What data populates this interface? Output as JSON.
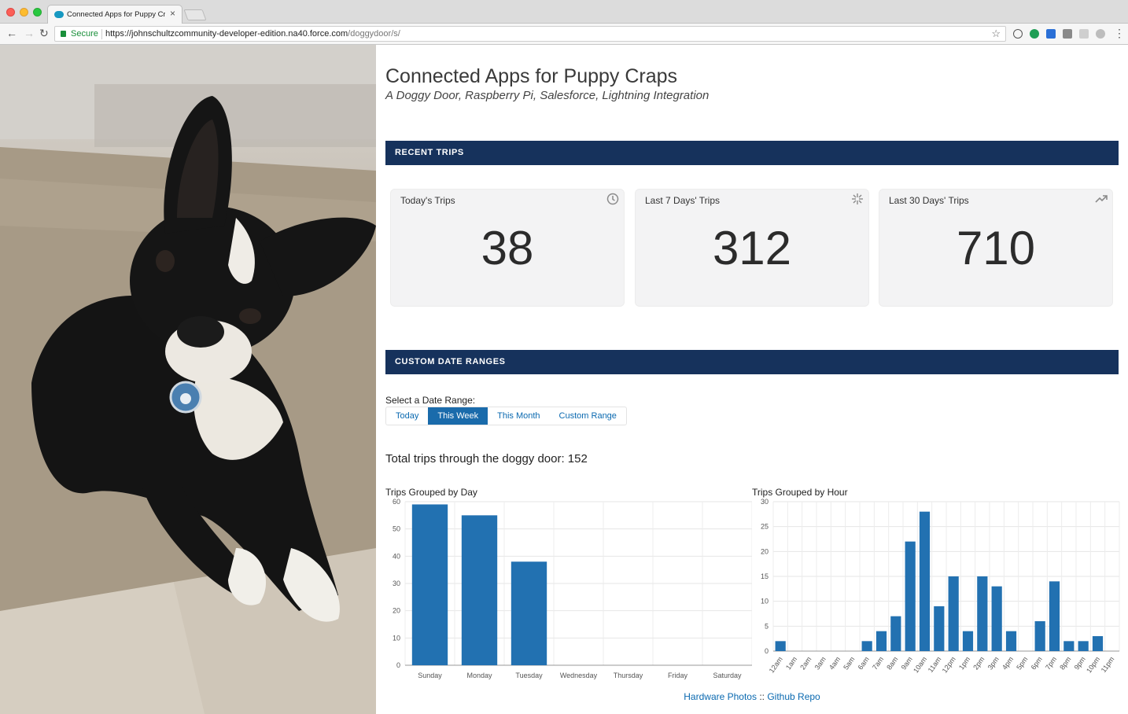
{
  "browser": {
    "tab_title": "Connected Apps for Puppy Cr",
    "tab_close": "×",
    "secure_label": "Secure",
    "url_host": "https://johnschultzcommunity-developer-edition.na40.force.com",
    "url_path": "/doggydoor/s/",
    "back_icon": "arrow-left-icon",
    "forward_icon": "arrow-right-icon",
    "reload_icon": "reload-icon"
  },
  "page": {
    "title": "Connected Apps for Puppy Craps",
    "subtitle": "A Doggy Door, Raspberry Pi, Salesforce, Lightning Integration"
  },
  "recent_trips": {
    "heading": "RECENT TRIPS",
    "cards": [
      {
        "label": "Today's Trips",
        "value": "38",
        "icon": "clock-icon"
      },
      {
        "label": "Last 7 Days' Trips",
        "value": "312",
        "icon": "sparkle-icon"
      },
      {
        "label": "Last 30 Days' Trips",
        "value": "710",
        "icon": "trend-up-icon"
      }
    ]
  },
  "custom_ranges": {
    "heading": "CUSTOM DATE RANGES",
    "select_label": "Select a Date Range:",
    "buttons": [
      "Today",
      "This Week",
      "This Month",
      "Custom Range"
    ],
    "selected": "This Week",
    "total_text": "Total trips through the doggy door: 152"
  },
  "footer": {
    "link1": "Hardware Photos",
    "separator": "::",
    "link2": "Github Repo"
  },
  "colors": {
    "section_bar": "#16325c",
    "bar": "#2271b1",
    "link": "#0a69b0"
  },
  "chart_data": [
    {
      "type": "bar",
      "title": "Trips Grouped by Day",
      "categories": [
        "Sunday",
        "Monday",
        "Tuesday",
        "Wednesday",
        "Thursday",
        "Friday",
        "Saturday"
      ],
      "values": [
        59,
        55,
        38,
        0,
        0,
        0,
        0
      ],
      "ylim": [
        0,
        60
      ],
      "yticks": [
        0,
        10,
        20,
        30,
        40,
        50,
        60
      ],
      "grid": true
    },
    {
      "type": "bar",
      "title": "Trips Grouped by Hour",
      "categories": [
        "12am",
        "1am",
        "2am",
        "3am",
        "4am",
        "5am",
        "6am",
        "7am",
        "8am",
        "9am",
        "10am",
        "11am",
        "12pm",
        "1pm",
        "2pm",
        "3pm",
        "4pm",
        "5pm",
        "6pm",
        "7pm",
        "8pm",
        "9pm",
        "10pm",
        "11pm"
      ],
      "values": [
        2,
        0,
        0,
        0,
        0,
        0,
        2,
        4,
        7,
        22,
        28,
        9,
        15,
        4,
        15,
        13,
        4,
        0,
        6,
        14,
        2,
        2,
        3,
        0
      ],
      "ylim": [
        0,
        30
      ],
      "yticks": [
        0,
        5,
        10,
        15,
        20,
        25,
        30
      ],
      "grid": true
    }
  ]
}
